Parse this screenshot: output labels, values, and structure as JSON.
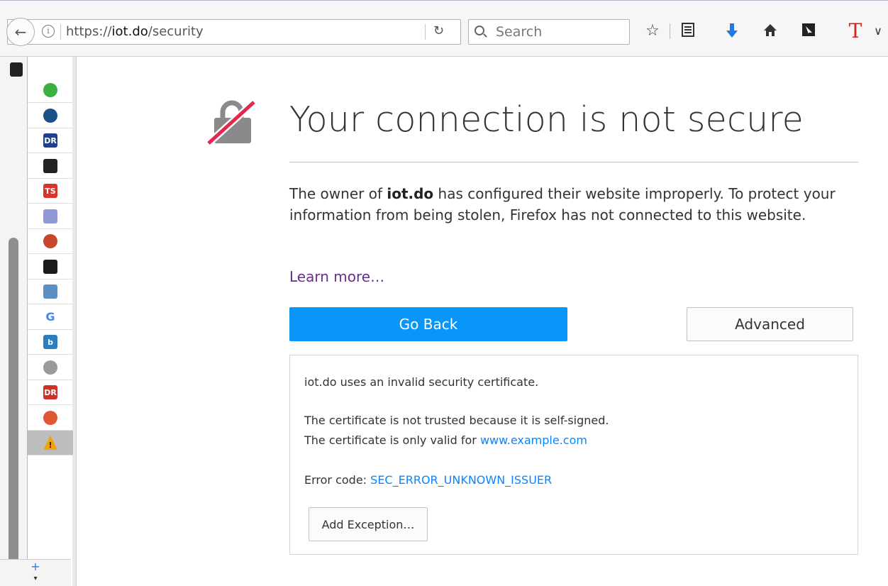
{
  "toolbar": {
    "url_prefix": "https://",
    "url_host": "iot.do",
    "url_path": "/security",
    "search_placeholder": "Search",
    "icons": [
      "back-arrow-icon",
      "info-icon",
      "reload-icon",
      "search-icon",
      "bookmark-star-icon",
      "reading-list-icon",
      "download-arrow-icon",
      "home-icon",
      "extension-square-icon",
      "t-extension-icon",
      "overflow-chevron-icon"
    ],
    "t_glyph": "T"
  },
  "sidebar": {
    "tabs": [
      {
        "name": "sidebar-tab-green",
        "color": "#3cb043",
        "glyph": ""
      },
      {
        "name": "sidebar-tab-blue-circle",
        "color": "#1b4f8a",
        "glyph": ""
      },
      {
        "name": "sidebar-tab-dr-1",
        "color": "#1f3f8f",
        "glyph": "DR"
      },
      {
        "name": "sidebar-tab-stripes",
        "color": "#222222",
        "glyph": ""
      },
      {
        "name": "sidebar-tab-ts",
        "color": "#d9342b",
        "glyph": "TS"
      },
      {
        "name": "sidebar-tab-ssrn",
        "color": "#8f9ad9",
        "glyph": ""
      },
      {
        "name": "sidebar-tab-orb",
        "color": "#c8462b",
        "glyph": ""
      },
      {
        "name": "sidebar-tab-person",
        "color": "#1a1a1a",
        "glyph": ""
      },
      {
        "name": "sidebar-tab-box",
        "color": "#5a8fc2",
        "glyph": ""
      },
      {
        "name": "sidebar-tab-google",
        "color": "#ffffff",
        "glyph": "G"
      },
      {
        "name": "sidebar-tab-b",
        "color": "#2a7fc0",
        "glyph": "b"
      },
      {
        "name": "sidebar-tab-globe",
        "color": "#9a9a9a",
        "glyph": ""
      },
      {
        "name": "sidebar-tab-dr-2",
        "color": "#c8342b",
        "glyph": "DR"
      },
      {
        "name": "sidebar-tab-duck",
        "color": "#de5833",
        "glyph": ""
      },
      {
        "name": "sidebar-tab-warning",
        "color": "#f0a30a",
        "glyph": "!"
      }
    ],
    "add_label": "+"
  },
  "main": {
    "title": "Your connection is not secure",
    "para_pre": "The owner of ",
    "para_host": "iot.do",
    "para_post": " has configured their website improperly. To protect your information from being stolen, Firefox has not connected to this website.",
    "learn_more": "Learn more…",
    "go_back_label": "Go Back",
    "advanced_label": "Advanced"
  },
  "details": {
    "line1": "iot.do uses an invalid security certificate.",
    "line2": "The certificate is not trusted because it is self-signed.",
    "line3_pre": "The certificate is only valid for ",
    "line3_link": "www.example.com",
    "error_pre": "Error code: ",
    "error_code": "SEC_ERROR_UNKNOWN_ISSUER",
    "add_exception_label": "Add Exception…"
  },
  "colors": {
    "accent_blue": "#0996f8",
    "link_blue": "#0a84ff",
    "visited_purple": "#6a2c8f",
    "lock_red": "#e22850"
  }
}
